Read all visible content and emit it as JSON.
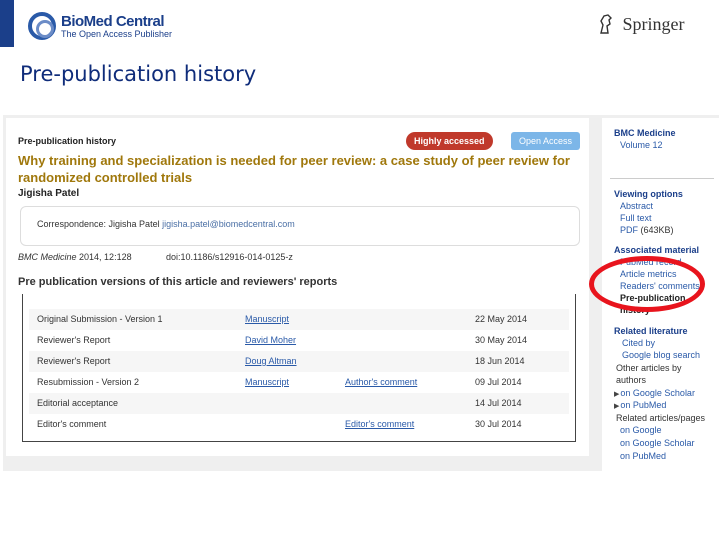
{
  "header": {
    "publisher_logo_name": "BioMed Central",
    "publisher_logo_tagline": "The Open Access Publisher",
    "springer_logo_text": "Springer"
  },
  "slide_title": "Pre-publication history",
  "article_page": {
    "section_heading": "Pre-publication history",
    "badge_highly_accessed": "Highly accessed",
    "badge_open_access": "Open Access",
    "title": "Why training and specialization is needed for peer review: a case study of peer review for randomized controlled trials",
    "author": "Jigisha Patel",
    "correspondence_label": "Correspondence: Jigisha Patel ",
    "correspondence_email": "jigisha.patel@biomedcentral.com",
    "citation_journal": "BMC Medicine",
    "citation_rest": " 2014, 12:128",
    "doi": "doi:10.1186/s12916-014-0125-z",
    "versions_heading": "Pre publication versions of this article and reviewers' reports",
    "history": [
      {
        "stage": "Original Submission - Version 1",
        "document": "Manuscript",
        "extra": "",
        "date": "22 May 2014"
      },
      {
        "stage": "Reviewer's Report",
        "document": "David Moher",
        "extra": "",
        "date": "30 May 2014"
      },
      {
        "stage": "Reviewer's Report",
        "document": "Doug Altman",
        "extra": "",
        "date": "18 Jun 2014"
      },
      {
        "stage": "Resubmission - Version 2",
        "document": "Manuscript",
        "extra": "Author's comment",
        "date": "09 Jul 2014"
      },
      {
        "stage": "Editorial acceptance",
        "document": "",
        "extra": "",
        "date": "14 Jul 2014"
      },
      {
        "stage": "Editor's comment",
        "document": "",
        "extra": "Editor's comment",
        "date": "30 Jul 2014"
      }
    ]
  },
  "sidebar": {
    "journal": "BMC Medicine",
    "volume": "Volume 12",
    "viewing_options_heading": "Viewing options",
    "abstract": "Abstract",
    "full_text": "Full text",
    "pdf": "PDF",
    "pdf_size": "(643KB)",
    "associated_material_heading": "Associated material",
    "pubmed_record": "PubMed record",
    "article_metrics": "Article metrics",
    "readers_comments": "Readers' comments",
    "prepub_line1": "Pre-publication",
    "prepub_line2": "history",
    "related_literature_heading": "Related literature",
    "cited_by": "Cited by",
    "google_blog_search": "Google blog search",
    "other_articles_line1": "Other articles by",
    "other_articles_line2": "authors",
    "on_google_scholar": "on Google Scholar",
    "on_pubmed": "on PubMed",
    "related_pages_line1": "Related articles/pages",
    "on_google": "on Google",
    "on_google_scholar_2": "on Google Scholar",
    "on_pubmed_2": "on PubMed"
  },
  "colors": {
    "title_blue": "#0f2c7a",
    "article_title_gold": "#a0780c",
    "highlight_red": "#e8141d",
    "badge_red": "#c0392b",
    "badge_blue": "#7cb6e8"
  }
}
